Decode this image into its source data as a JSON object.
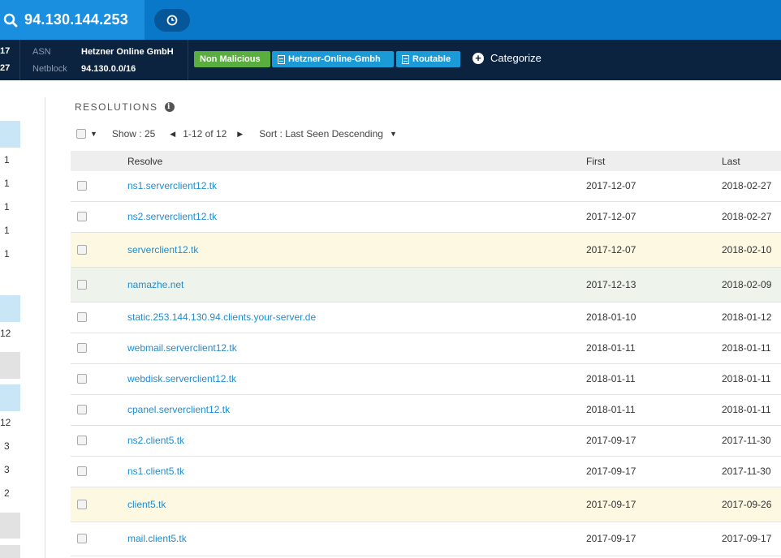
{
  "header": {
    "ip": "94.130.144.253"
  },
  "infobar": {
    "left_nums": [
      "17",
      "27"
    ],
    "asn_label": "ASN",
    "asn_value": "Hetzner Online GmbH",
    "netblock_label": "Netblock",
    "netblock_value": "94.130.0.0/16",
    "tags": {
      "non_malicious": "Non Malicious",
      "hetzner": "Hetzner-Online-Gmbh",
      "routable": "Routable"
    },
    "categorize": "Categorize",
    "colors": {
      "green": "#5aad3f",
      "blue": "#1a9ad6",
      "bar": "#0c2340"
    }
  },
  "sidebar": {
    "nums": [
      "1",
      "1",
      "1",
      "1",
      "1",
      "12",
      "12",
      "3",
      "3",
      "2"
    ]
  },
  "resolutions": {
    "title": "RESOLUTIONS",
    "show": "Show : 25",
    "range": "1-12 of 12",
    "sort": "Sort : Last Seen Descending",
    "columns": {
      "resolve": "Resolve",
      "first": "First",
      "last": "Last"
    },
    "rows": [
      {
        "resolve": "ns1.serverclient12.tk",
        "first": "2017-12-07",
        "last": "2018-02-27",
        "highlight": "none"
      },
      {
        "resolve": "ns2.serverclient12.tk",
        "first": "2017-12-07",
        "last": "2018-02-27",
        "highlight": "none"
      },
      {
        "resolve": "serverclient12.tk",
        "first": "2017-12-07",
        "last": "2018-02-10",
        "highlight": "yellow"
      },
      {
        "resolve": "namazhe.net",
        "first": "2017-12-13",
        "last": "2018-02-09",
        "highlight": "green"
      },
      {
        "resolve": "static.253.144.130.94.clients.your-server.de",
        "first": "2018-01-10",
        "last": "2018-01-12",
        "highlight": "none"
      },
      {
        "resolve": "webmail.serverclient12.tk",
        "first": "2018-01-11",
        "last": "2018-01-11",
        "highlight": "none"
      },
      {
        "resolve": "webdisk.serverclient12.tk",
        "first": "2018-01-11",
        "last": "2018-01-11",
        "highlight": "none"
      },
      {
        "resolve": "cpanel.serverclient12.tk",
        "first": "2018-01-11",
        "last": "2018-01-11",
        "highlight": "none"
      },
      {
        "resolve": "ns2.client5.tk",
        "first": "2017-09-17",
        "last": "2017-11-30",
        "highlight": "none"
      },
      {
        "resolve": "ns1.client5.tk",
        "first": "2017-09-17",
        "last": "2017-11-30",
        "highlight": "none"
      },
      {
        "resolve": "client5.tk",
        "first": "2017-09-17",
        "last": "2017-09-26",
        "highlight": "yellow"
      },
      {
        "resolve": "mail.client5.tk",
        "first": "2017-09-17",
        "last": "2017-09-17",
        "highlight": "none"
      }
    ]
  }
}
